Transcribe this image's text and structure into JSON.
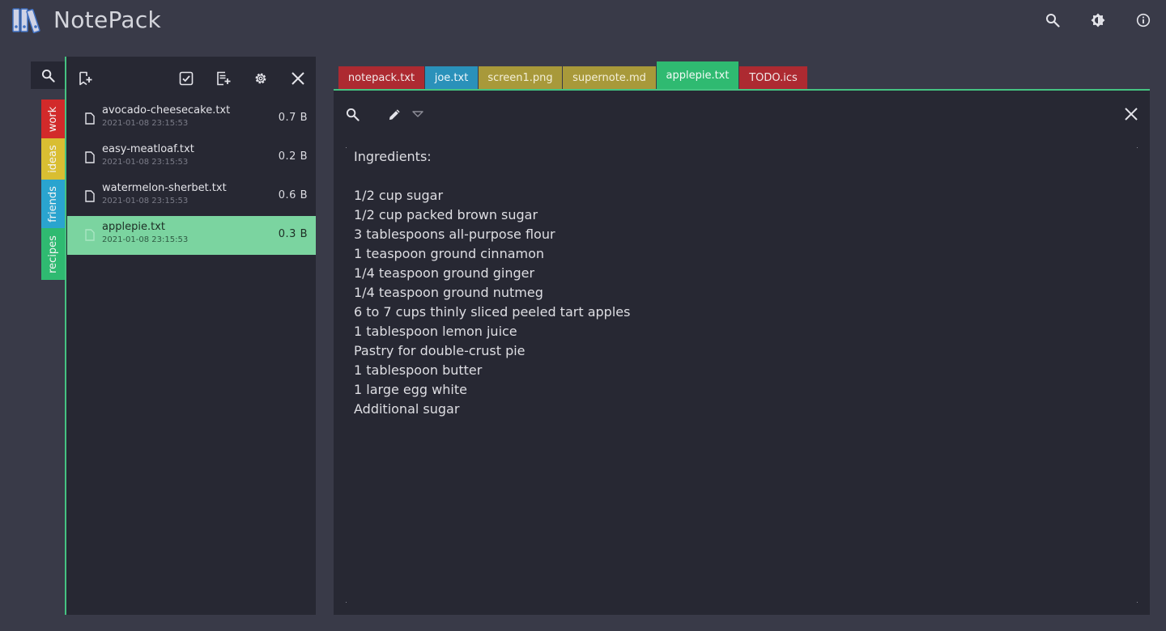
{
  "app": {
    "title": "NotePack"
  },
  "header_icons": [
    "search-icon",
    "brightness-icon",
    "info-icon"
  ],
  "sidebar": {
    "folders": [
      {
        "label": "work",
        "color": "#d22a2a"
      },
      {
        "label": "ideas",
        "color": "#d9be32"
      },
      {
        "label": "friends",
        "color": "#2aa4cf"
      },
      {
        "label": "recipes",
        "color": "#2fba71"
      }
    ]
  },
  "file_panel": {
    "files": [
      {
        "name": "avocado-cheesecake.txt",
        "date": "2021-01-08 23:15:53",
        "size": "0.7  B"
      },
      {
        "name": "easy-meatloaf.txt",
        "date": "2021-01-08 23:15:53",
        "size": "0.2  B"
      },
      {
        "name": "watermelon-sherbet.txt",
        "date": "2021-01-08 23:15:53",
        "size": "0.6  B"
      },
      {
        "name": "applepie.txt",
        "date": "2021-01-08 23:15:53",
        "size": "0.3  B",
        "selected": true
      }
    ]
  },
  "tabs": [
    {
      "label": "notepack.txt",
      "bg": "#ad2a31",
      "fg": "#f1e8e8"
    },
    {
      "label": "joe.txt",
      "bg": "#2a91ba",
      "fg": "#eef6fa"
    },
    {
      "label": "screen1.png",
      "bg": "#a8993a",
      "fg": "#f3efd8"
    },
    {
      "label": "supernote.md",
      "bg": "#a8993a",
      "fg": "#f3efd8"
    },
    {
      "label": "applepie.txt",
      "bg": "#2fba71",
      "fg": "#f3fbf6",
      "active": true
    },
    {
      "label": "TODO.ics",
      "bg": "#ad2a31",
      "fg": "#f1e8e8"
    }
  ],
  "editor": {
    "lines": [
      "Ingredients:",
      "",
      "1/2 cup sugar",
      "1/2 cup packed brown sugar",
      "3 tablespoons all-purpose flour",
      "1 teaspoon ground cinnamon",
      "1/4 teaspoon ground ginger",
      "1/4 teaspoon ground nutmeg",
      "6 to 7 cups thinly sliced peeled tart apples",
      "1 tablespoon lemon juice",
      "Pastry for double-crust pie",
      "1 tablespoon butter",
      "1 large egg white",
      "Additional sugar"
    ]
  },
  "colors": {
    "accent": "#45c281",
    "background": "#393a48",
    "panel": "#272833",
    "selected_row": "#7bd4a0"
  }
}
